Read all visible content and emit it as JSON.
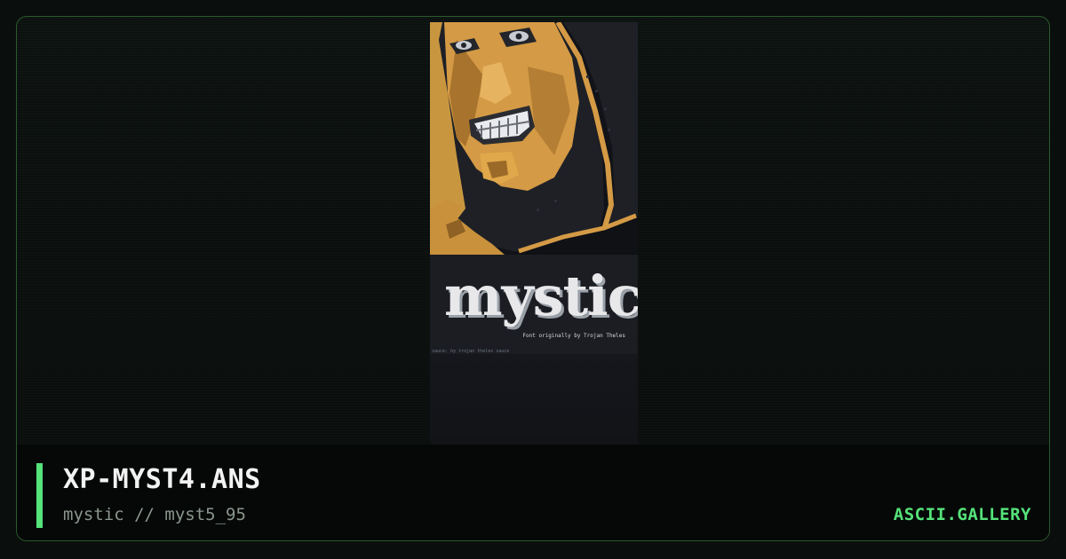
{
  "artwork": {
    "logo_text": "mystic",
    "credit_text": "Font originally by Trojan Theles",
    "sauce_text": "sauce: by trojan theles sauce"
  },
  "footer": {
    "title": "XP-MYST4.ANS",
    "subtitle": "mystic // myst5_95",
    "brand": "ASCII.GALLERY"
  },
  "colors": {
    "accent": "#55e37a",
    "frame_border": "#2b5a2b",
    "art_gold": "#e0a84a",
    "art_bg": "#1b1d22"
  }
}
